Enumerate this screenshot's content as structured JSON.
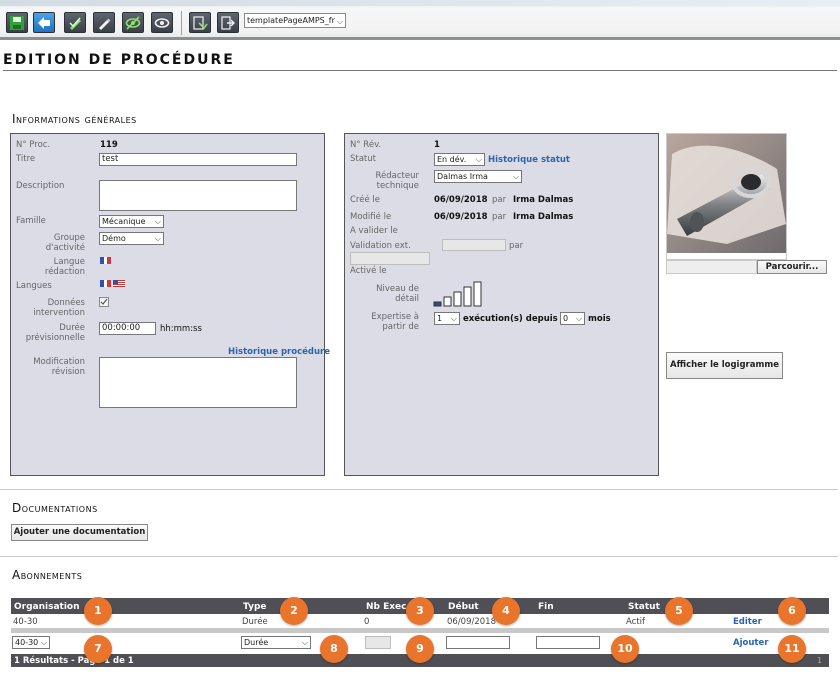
{
  "toolbar": {
    "icons": [
      "save-icon",
      "back-icon",
      "validate-icon",
      "edit-icon",
      "hide-icon",
      "view-icon",
      "export-icon",
      "exit-icon"
    ],
    "template_select": "templatePageAMPS_fr"
  },
  "page_title": "Edition de procédure",
  "general": {
    "section_title": "Informations générales",
    "left": {
      "proc_label": "N° Proc.",
      "proc_value": "119",
      "title_label": "Titre",
      "title_value": "test",
      "description_label": "Description",
      "family_label": "Famille",
      "family_value": "Mécanique",
      "group_label": "Groupe d'activité",
      "group_value": "Démo",
      "lang_label": "Langue rédaction",
      "langs_label": "Langues",
      "data_label": "Données intervention",
      "duration_label": "Durée prévisionnelle",
      "duration_value": "00:00:00",
      "duration_unit": "hh:mm:ss",
      "history_link": "Historique procédure",
      "modif_label": "Modification révision"
    },
    "middle": {
      "rev_label": "N° Rév.",
      "rev_value": "1",
      "status_label": "Statut",
      "status_value": "En dév.",
      "status_history_link": "Historique statut",
      "writer_label": "Rédacteur technique",
      "writer_value": "Dalmas Irma",
      "created_label": "Créé le",
      "created_date": "06/09/2018",
      "par": "par",
      "created_by": "Irma Dalmas",
      "modified_label": "Modifié le",
      "modified_date": "06/09/2018",
      "modified_by": "Irma Dalmas",
      "to_validate_label": "A valider le",
      "ext_validation_label": "Validation ext.",
      "activated_label": "Activé le",
      "level_label": "Niveau de détail",
      "level_value": 1,
      "level_max": 5,
      "expertise_label": "Expertise à partir de",
      "expertise_count": "1",
      "expertise_text": "exécution(s) depuis",
      "expertise_months": "0",
      "months_label": "mois"
    },
    "image": {
      "browse_button": "Parcourir..."
    },
    "flowchart_button": "Afficher le logigramme"
  },
  "documentation": {
    "section_title": "Documentations",
    "add_button": "Ajouter une documentation"
  },
  "subscriptions": {
    "section_title": "Abonnements",
    "columns": [
      "Organisation",
      "Type",
      "Nb Exec",
      "Début",
      "Fin",
      "Statut"
    ],
    "row": {
      "organisation": "40-30",
      "type": "Durée",
      "nb_exec": "0",
      "debut": "06/09/2018",
      "fin": "",
      "statut": "Actif",
      "action": "Editer"
    },
    "new_row": {
      "organisation": "40-30",
      "type": "Durée",
      "action": "Ajouter"
    },
    "footer": "1 Résultats - Page 1 de 1",
    "footer_right": "1",
    "markers": [
      "1",
      "2",
      "3",
      "4",
      "5",
      "6",
      "7",
      "8",
      "9",
      "10",
      "11"
    ]
  },
  "colors": {
    "accent_link": "#2a66b0",
    "marker": "#e8752b",
    "panel_bg": "#dcdce6",
    "table_header": "#4f4f55"
  }
}
